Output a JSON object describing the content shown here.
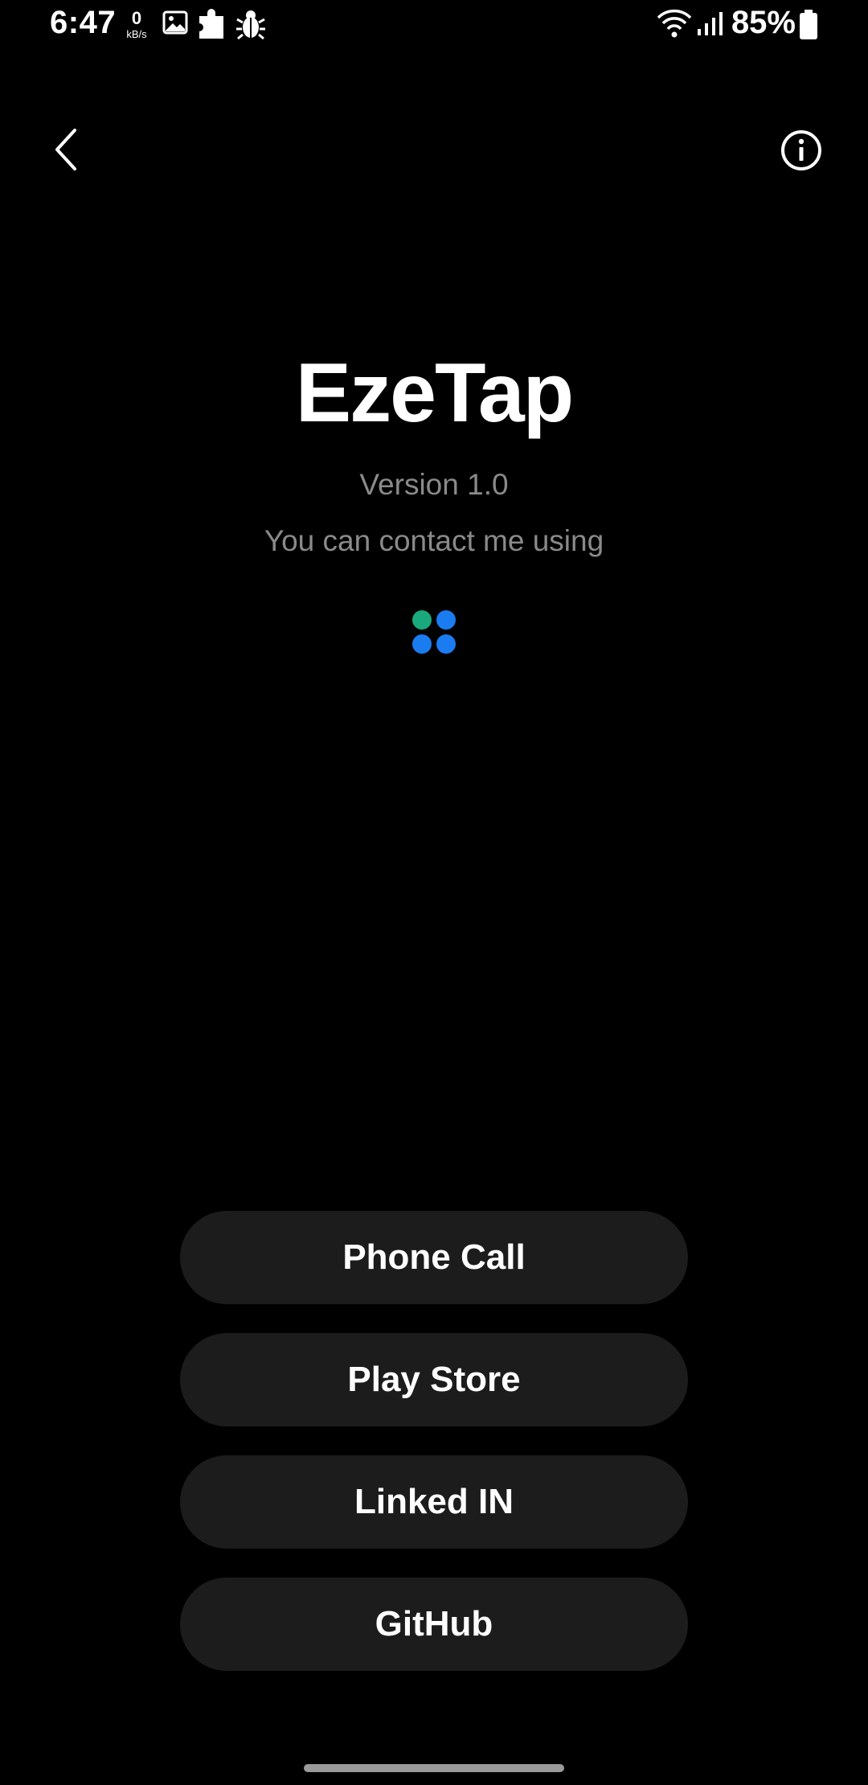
{
  "status_bar": {
    "time": "6:47",
    "net_speed_value": "0",
    "net_speed_unit": "kB/s",
    "battery_percent": "85%",
    "icons": [
      "image-icon",
      "puzzle-icon",
      "bug-icon",
      "wifi-icon",
      "signal-icon",
      "battery-icon"
    ]
  },
  "app_bar": {
    "back_icon": "chevron-left-icon",
    "info_icon": "info-icon"
  },
  "header": {
    "title": "EzeTap",
    "version": "Version 1.0",
    "subtitle": "You can contact me using",
    "icon": "apps-grid-icon"
  },
  "buttons": {
    "phone_call": "Phone Call",
    "play_store": "Play Store",
    "linkedin": "Linked IN",
    "github": "GitHub"
  },
  "colors": {
    "background": "#000000",
    "button_bg": "#1c1c1c",
    "secondary_text": "#8a8a8a",
    "dot_green": "#1aa87e",
    "dot_blue": "#1a7cf0"
  }
}
